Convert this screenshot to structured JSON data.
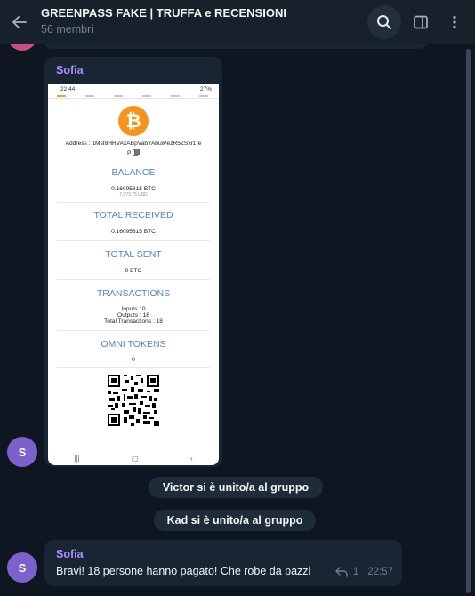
{
  "header": {
    "title": "GREENPASS FAKE | TRUFFA e RECENSIONI",
    "subtitle": "56 membri"
  },
  "messages": [
    {
      "sender": "Sofia",
      "avatar_letter": "S",
      "photo": {
        "status_time": "22:44",
        "status_battery": "27%",
        "address_label": "Address : 1Msf8HRVAxABpVabYAbuiPezR5ZSxr1re",
        "address_tail": "P",
        "sections": [
          {
            "title": "BALANCE",
            "value": "0.16095815 BTC",
            "subvalue": "7,073.75 USD"
          },
          {
            "title": "TOTAL RECEIVED",
            "value": "0.16095815 BTC"
          },
          {
            "title": "TOTAL SENT",
            "value": "0 BTC"
          },
          {
            "title": "TRANSACTIONS",
            "lines": [
              "Inputs : 0",
              "Outputs : 18",
              "Total Transactions : 18"
            ]
          },
          {
            "title": "OMNI TOKENS",
            "value": "0"
          }
        ]
      }
    },
    {
      "sender": "Sofia",
      "avatar_letter": "S",
      "text": "Bravi! 18 persone hanno pagato! Che robe da pazzi",
      "replies": "1",
      "time": "22:57"
    }
  ],
  "service_messages": [
    "Victor si è unito/a al gruppo",
    "Kad si è unito/a al gruppo"
  ],
  "colors": {
    "background": "#0e1621",
    "header": "#17212b",
    "bubble": "#182533",
    "sender_name": "#b08dfd",
    "avatar": "#7b61c9",
    "bitcoin": "#f7931a"
  },
  "icons": [
    "back-arrow-icon",
    "search-icon",
    "sidebar-toggle-icon",
    "more-vertical-icon",
    "copy-icon",
    "reply-icon"
  ]
}
